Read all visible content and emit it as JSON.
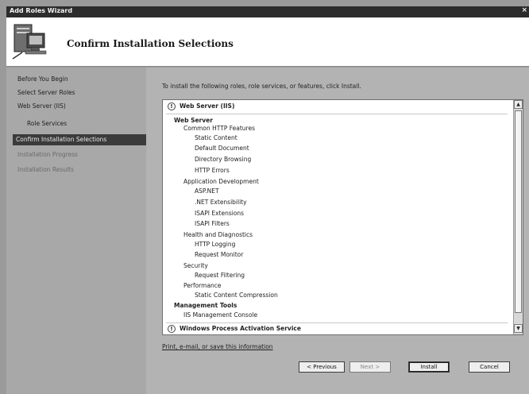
{
  "window": {
    "title": "Add Roles Wizard",
    "close_glyph": "×"
  },
  "header": {
    "title": "Confirm Installation Selections",
    "icon": "server-computer-icon"
  },
  "nav": {
    "items": [
      {
        "label": "Before You Begin",
        "state": "normal"
      },
      {
        "label": "Select Server Roles",
        "state": "normal"
      },
      {
        "label": "Web Server (IIS)",
        "state": "normal"
      },
      {
        "label": "Role Services",
        "state": "sub"
      },
      {
        "label": "Confirm Installation Selections",
        "state": "active"
      },
      {
        "label": "Installation Progress",
        "state": "disabled"
      },
      {
        "label": "Installation Results",
        "state": "disabled"
      }
    ]
  },
  "main": {
    "instruction": "To install the following roles, role services, or features, click Install.",
    "list": {
      "warning_glyph": "!",
      "section1_title": "Web Server (IIS)",
      "group_web_server": "Web Server",
      "common_http": "Common HTTP Features",
      "static_content": "Static Content",
      "default_document": "Default Document",
      "directory_browsing": "Directory Browsing",
      "http_errors": "HTTP Errors",
      "app_dev": "Application Development",
      "asp_net": "ASP.NET",
      "net_ext": ".NET Extensibility",
      "isapi_ext": "ISAPI Extensions",
      "isapi_filters": "ISAPI Filters",
      "health_diag": "Health and Diagnostics",
      "http_logging": "HTTP Logging",
      "request_monitor": "Request Monitor",
      "security": "Security",
      "request_filtering": "Request Filtering",
      "performance": "Performance",
      "static_compression": "Static Content Compression",
      "mgmt_tools": "Management Tools",
      "iis_console": "IIS Management Console",
      "section2_title": "Windows Process Activation Service"
    },
    "print_link": "Print, e-mail, or save this information",
    "scroll_up_glyph": "▲",
    "scroll_down_glyph": "▼"
  },
  "buttons": {
    "previous": "< Previous",
    "next": "Next >",
    "install": "Install",
    "cancel": "Cancel"
  }
}
